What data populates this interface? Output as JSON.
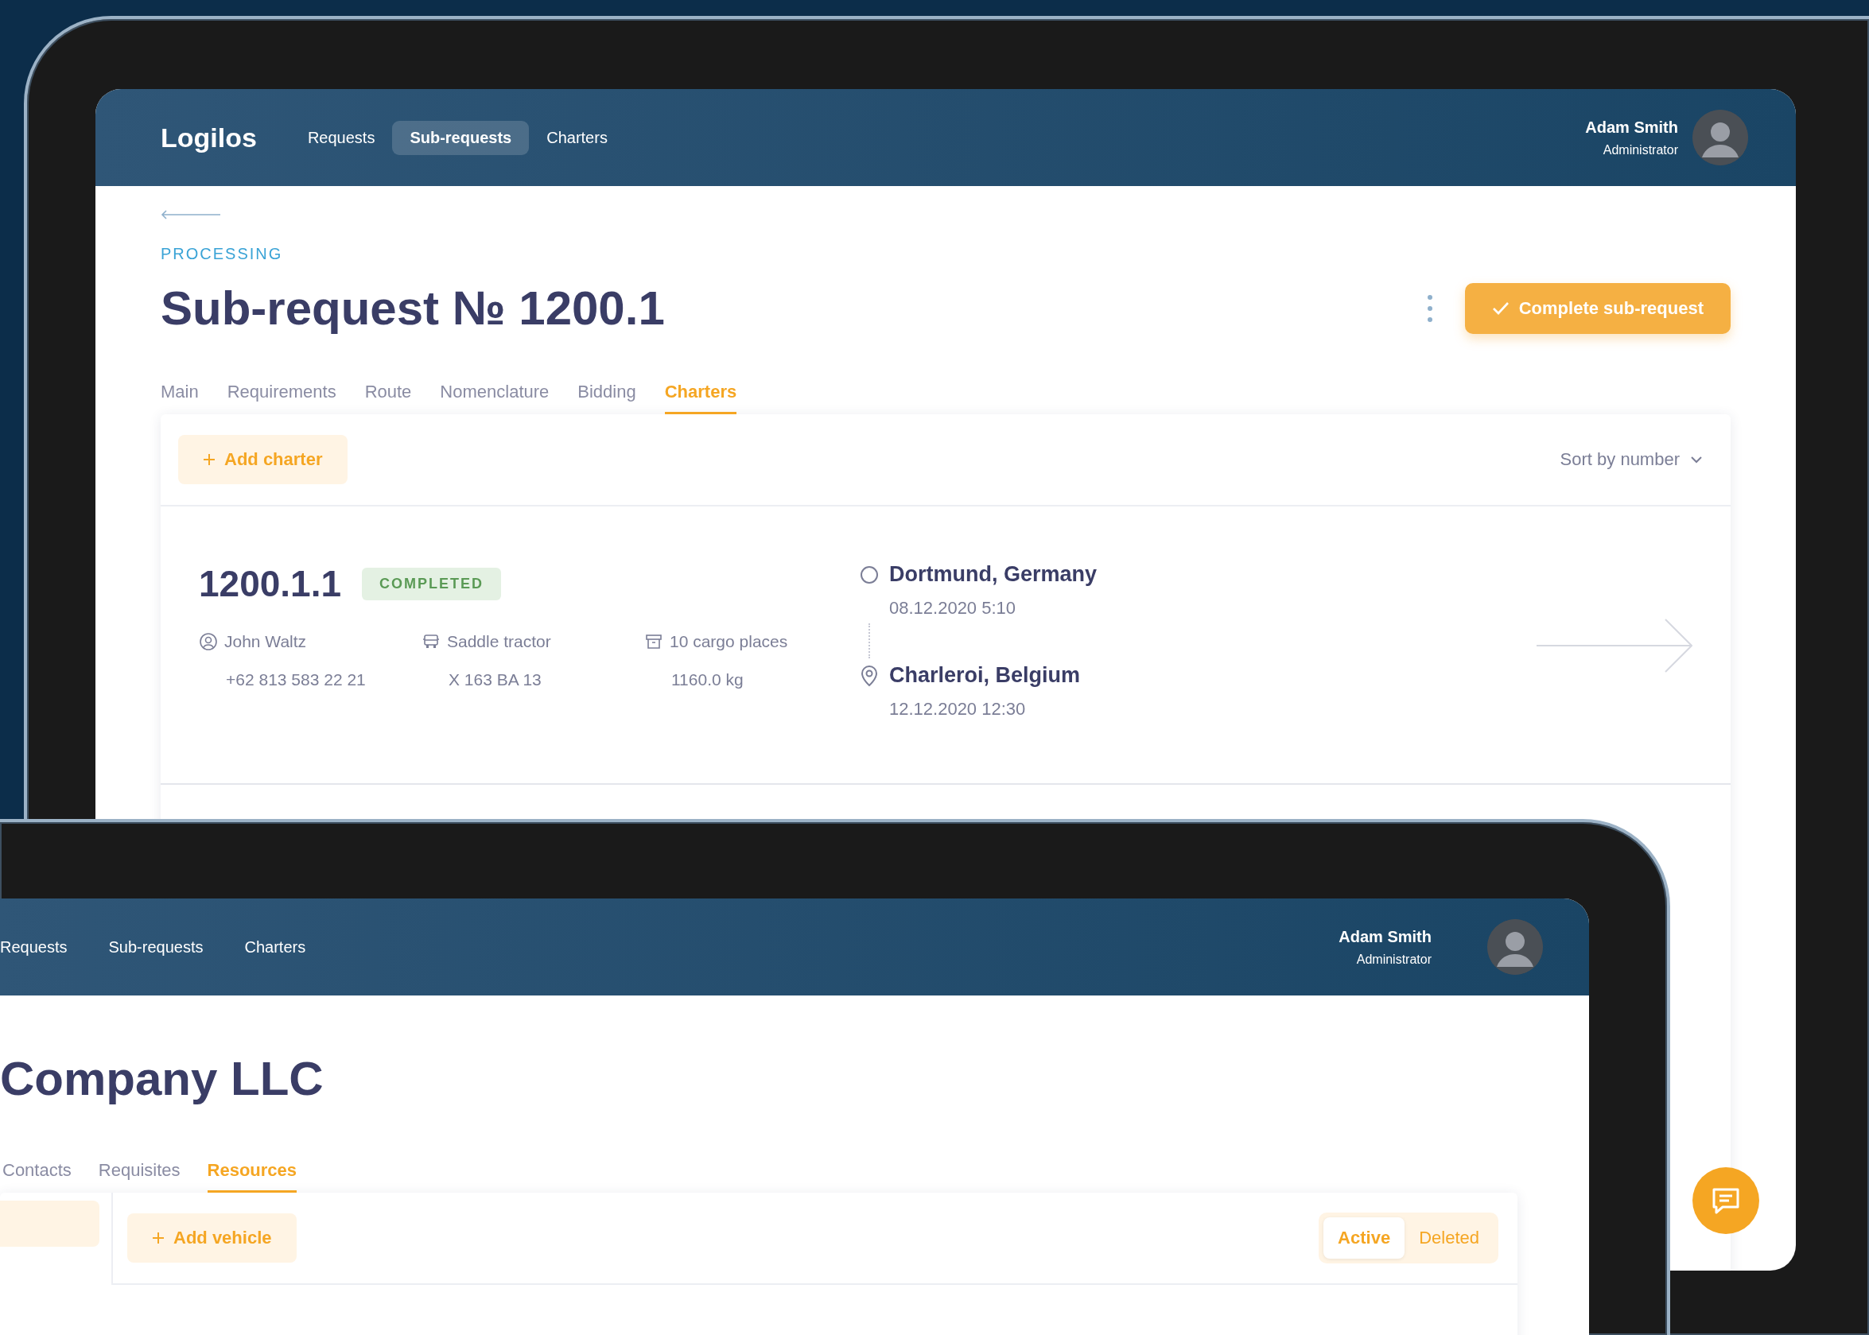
{
  "top_tablet": {
    "header": {
      "logo": "Logilos",
      "nav": [
        {
          "label": "Requests",
          "selected": false
        },
        {
          "label": "Sub-requests",
          "selected": true
        },
        {
          "label": "Charters",
          "selected": false
        }
      ],
      "user": {
        "name": "Adam Smith",
        "role": "Administrator"
      }
    },
    "status": "PROCESSING",
    "title": "Sub-request № 1200.1",
    "primary_button": "Complete sub-request",
    "tabs": [
      {
        "label": "Main",
        "selected": false
      },
      {
        "label": "Requirements",
        "selected": false
      },
      {
        "label": "Route",
        "selected": false
      },
      {
        "label": "Nomenclature",
        "selected": false
      },
      {
        "label": "Bidding",
        "selected": false
      },
      {
        "label": "Charters",
        "selected": true
      }
    ],
    "add_button": "Add charter",
    "sort": "Sort by number",
    "charters": [
      {
        "number": "1200.1.1",
        "status": "COMPLETED",
        "driver": "John Waltz",
        "phone": "+62 813 583 22 21",
        "vehicle": "Saddle tractor",
        "plate": "X 163 BA 13",
        "cargo": "10 cargo places",
        "weight": "1160.0 kg",
        "from": {
          "place": "Dortmund, Germany",
          "time": "08.12.2020 5:10"
        },
        "to": {
          "place": "Charleroi, Belgium",
          "time": "12.12.2020 12:30"
        }
      }
    ]
  },
  "bottom_tablet": {
    "header": {
      "nav": [
        {
          "label": "Requests",
          "selected": false
        },
        {
          "label": "Sub-requests",
          "selected": false
        },
        {
          "label": "Charters",
          "selected": false
        }
      ],
      "user": {
        "name": "Adam Smith",
        "role": "Administrator"
      }
    },
    "title": "Company LLC",
    "tabs": [
      {
        "label": "Contacts",
        "selected": false
      },
      {
        "label": "Requisites",
        "selected": false
      },
      {
        "label": "Resources",
        "selected": true
      }
    ],
    "add_button": "Add vehicle",
    "filter": [
      {
        "label": "Active",
        "selected": true
      },
      {
        "label": "Deleted",
        "selected": false
      }
    ]
  }
}
